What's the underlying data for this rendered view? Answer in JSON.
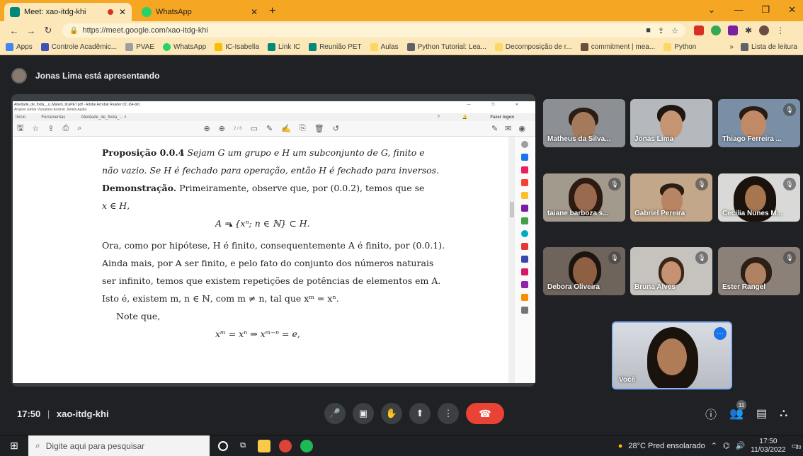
{
  "browser": {
    "tabs": [
      {
        "title": "Meet: xao-itdg-khi",
        "recording": true,
        "favicon_color": "#00897b"
      },
      {
        "title": "WhatsApp",
        "recording": false,
        "favicon_color": "#25d366"
      }
    ],
    "url": "https://meet.google.com/xao-itdg-khi",
    "bookmarks": [
      {
        "label": "Apps",
        "color": "#4285f4"
      },
      {
        "label": "Controle Acadêmic...",
        "color": "#3f51b5"
      },
      {
        "label": "PVAE",
        "color": "#9e9e9e"
      },
      {
        "label": "WhatsApp",
        "color": "#25d366"
      },
      {
        "label": "IC-Isabella",
        "color": "#fbbc04"
      },
      {
        "label": "Link IC",
        "color": "#00897b"
      },
      {
        "label": "Reunião PET",
        "color": "#00897b"
      },
      {
        "label": "Aulas",
        "color": "#fdd663"
      },
      {
        "label": "Python Tutorial: Lea...",
        "color": "#5f6368"
      },
      {
        "label": "Decomposição de r...",
        "color": "#fdd663"
      },
      {
        "label": "commitment | mea...",
        "color": "#6d4c41"
      },
      {
        "label": "Python",
        "color": "#fdd663"
      }
    ],
    "reading_list_label": "Lista de leitura"
  },
  "meet": {
    "presenter_text": "Jonas Lima está apresentando",
    "time": "17:50",
    "meeting_code": "xao-itdg-khi",
    "participant_count": "11",
    "participants": [
      {
        "name": "Matheus da Silva...",
        "muted": false,
        "bg": "#8c8f94",
        "skin": "#a57a5c",
        "hair": "#2b1d14"
      },
      {
        "name": "Jonas Lima",
        "muted": false,
        "bg": "#b5b9bd",
        "skin": "#c49473",
        "hair": "#1e1611"
      },
      {
        "name": "Thiago Ferreira ...",
        "muted": true,
        "bg": "#7a8fa6",
        "skin": "#c08a66",
        "hair": "#2a1c14"
      },
      {
        "name": "taiane barboza s...",
        "muted": true,
        "bg": "#a39a8e",
        "skin": "#9a6a4e",
        "hair": "#2b1b12"
      },
      {
        "name": "Gabriel Pereira",
        "muted": true,
        "bg": "#c2a78a",
        "skin": "#b78563",
        "hair": "#2a1d15"
      },
      {
        "name": "Cecilia Nunes M...",
        "muted": true,
        "bg": "#d9d9d7",
        "skin": "#a7754f",
        "hair": "#1a120c"
      },
      {
        "name": "Debora Oliveira",
        "muted": true,
        "bg": "#6f645c",
        "skin": "#8f5f43",
        "hair": "#1c1410"
      },
      {
        "name": "Bruna Alves",
        "muted": true,
        "bg": "#c6c2bd",
        "skin": "#c69273",
        "hair": "#3a2618"
      },
      {
        "name": "Ester Rangel",
        "muted": true,
        "bg": "#8b8179",
        "skin": "#b08264",
        "hair": "#2d1f16"
      }
    ],
    "self_label": "Você"
  },
  "acrobat": {
    "window_title": "Atividade_de_fixda__o_Matem_ticaPET.pdf - Adobe Acrobat Reader DC (64-bit)",
    "menu": "Arquivo  Editar  Visualizar  Assinar  Janela  Ajuda",
    "tabs": [
      "Início",
      "Ferramentas",
      "Atividade_de_fixda_... ×"
    ],
    "login_label": "Fazer logon",
    "page_indicator": "2 / 6"
  },
  "pdf": {
    "line1_bold": "Proposição 0.0.4",
    "line1_rest": "Sejam G um grupo e H um subconjunto de G, finito e",
    "line2": "não vazio. Se H é fechado para operação, então H é fechado para inversos.",
    "line3_bold": "Demonstração.",
    "line3_rest": "Primeiramente, observe que, por (0.0.2), temos que se",
    "line4": "x ∈ H,",
    "eq1": "A = {xⁿ; n ∈ ℕ} ⊂ H.",
    "line5": "Ora, como por hipótese, H é finito, consequentemente A é finito, por (0.0.1).",
    "line6": "Ainda mais, por A ser finito, e pelo fato do conjunto dos números naturais",
    "line7": "ser infinito, temos que existem repetições de potências de elementos em A.",
    "line8": "Isto é, existem m, n ∈ ℕ, com m ≠ n, tal que xᵐ = xⁿ.",
    "line9": "Note que,",
    "eq2": "xᵐ = xⁿ ⇒ xᵐ⁻ⁿ = e,"
  },
  "taskbar": {
    "search_placeholder": "Digite aqui para pesquisar",
    "weather": "28°C  Pred ensolarado",
    "time": "17:50",
    "date": "11/03/2022",
    "notifications": "10"
  }
}
